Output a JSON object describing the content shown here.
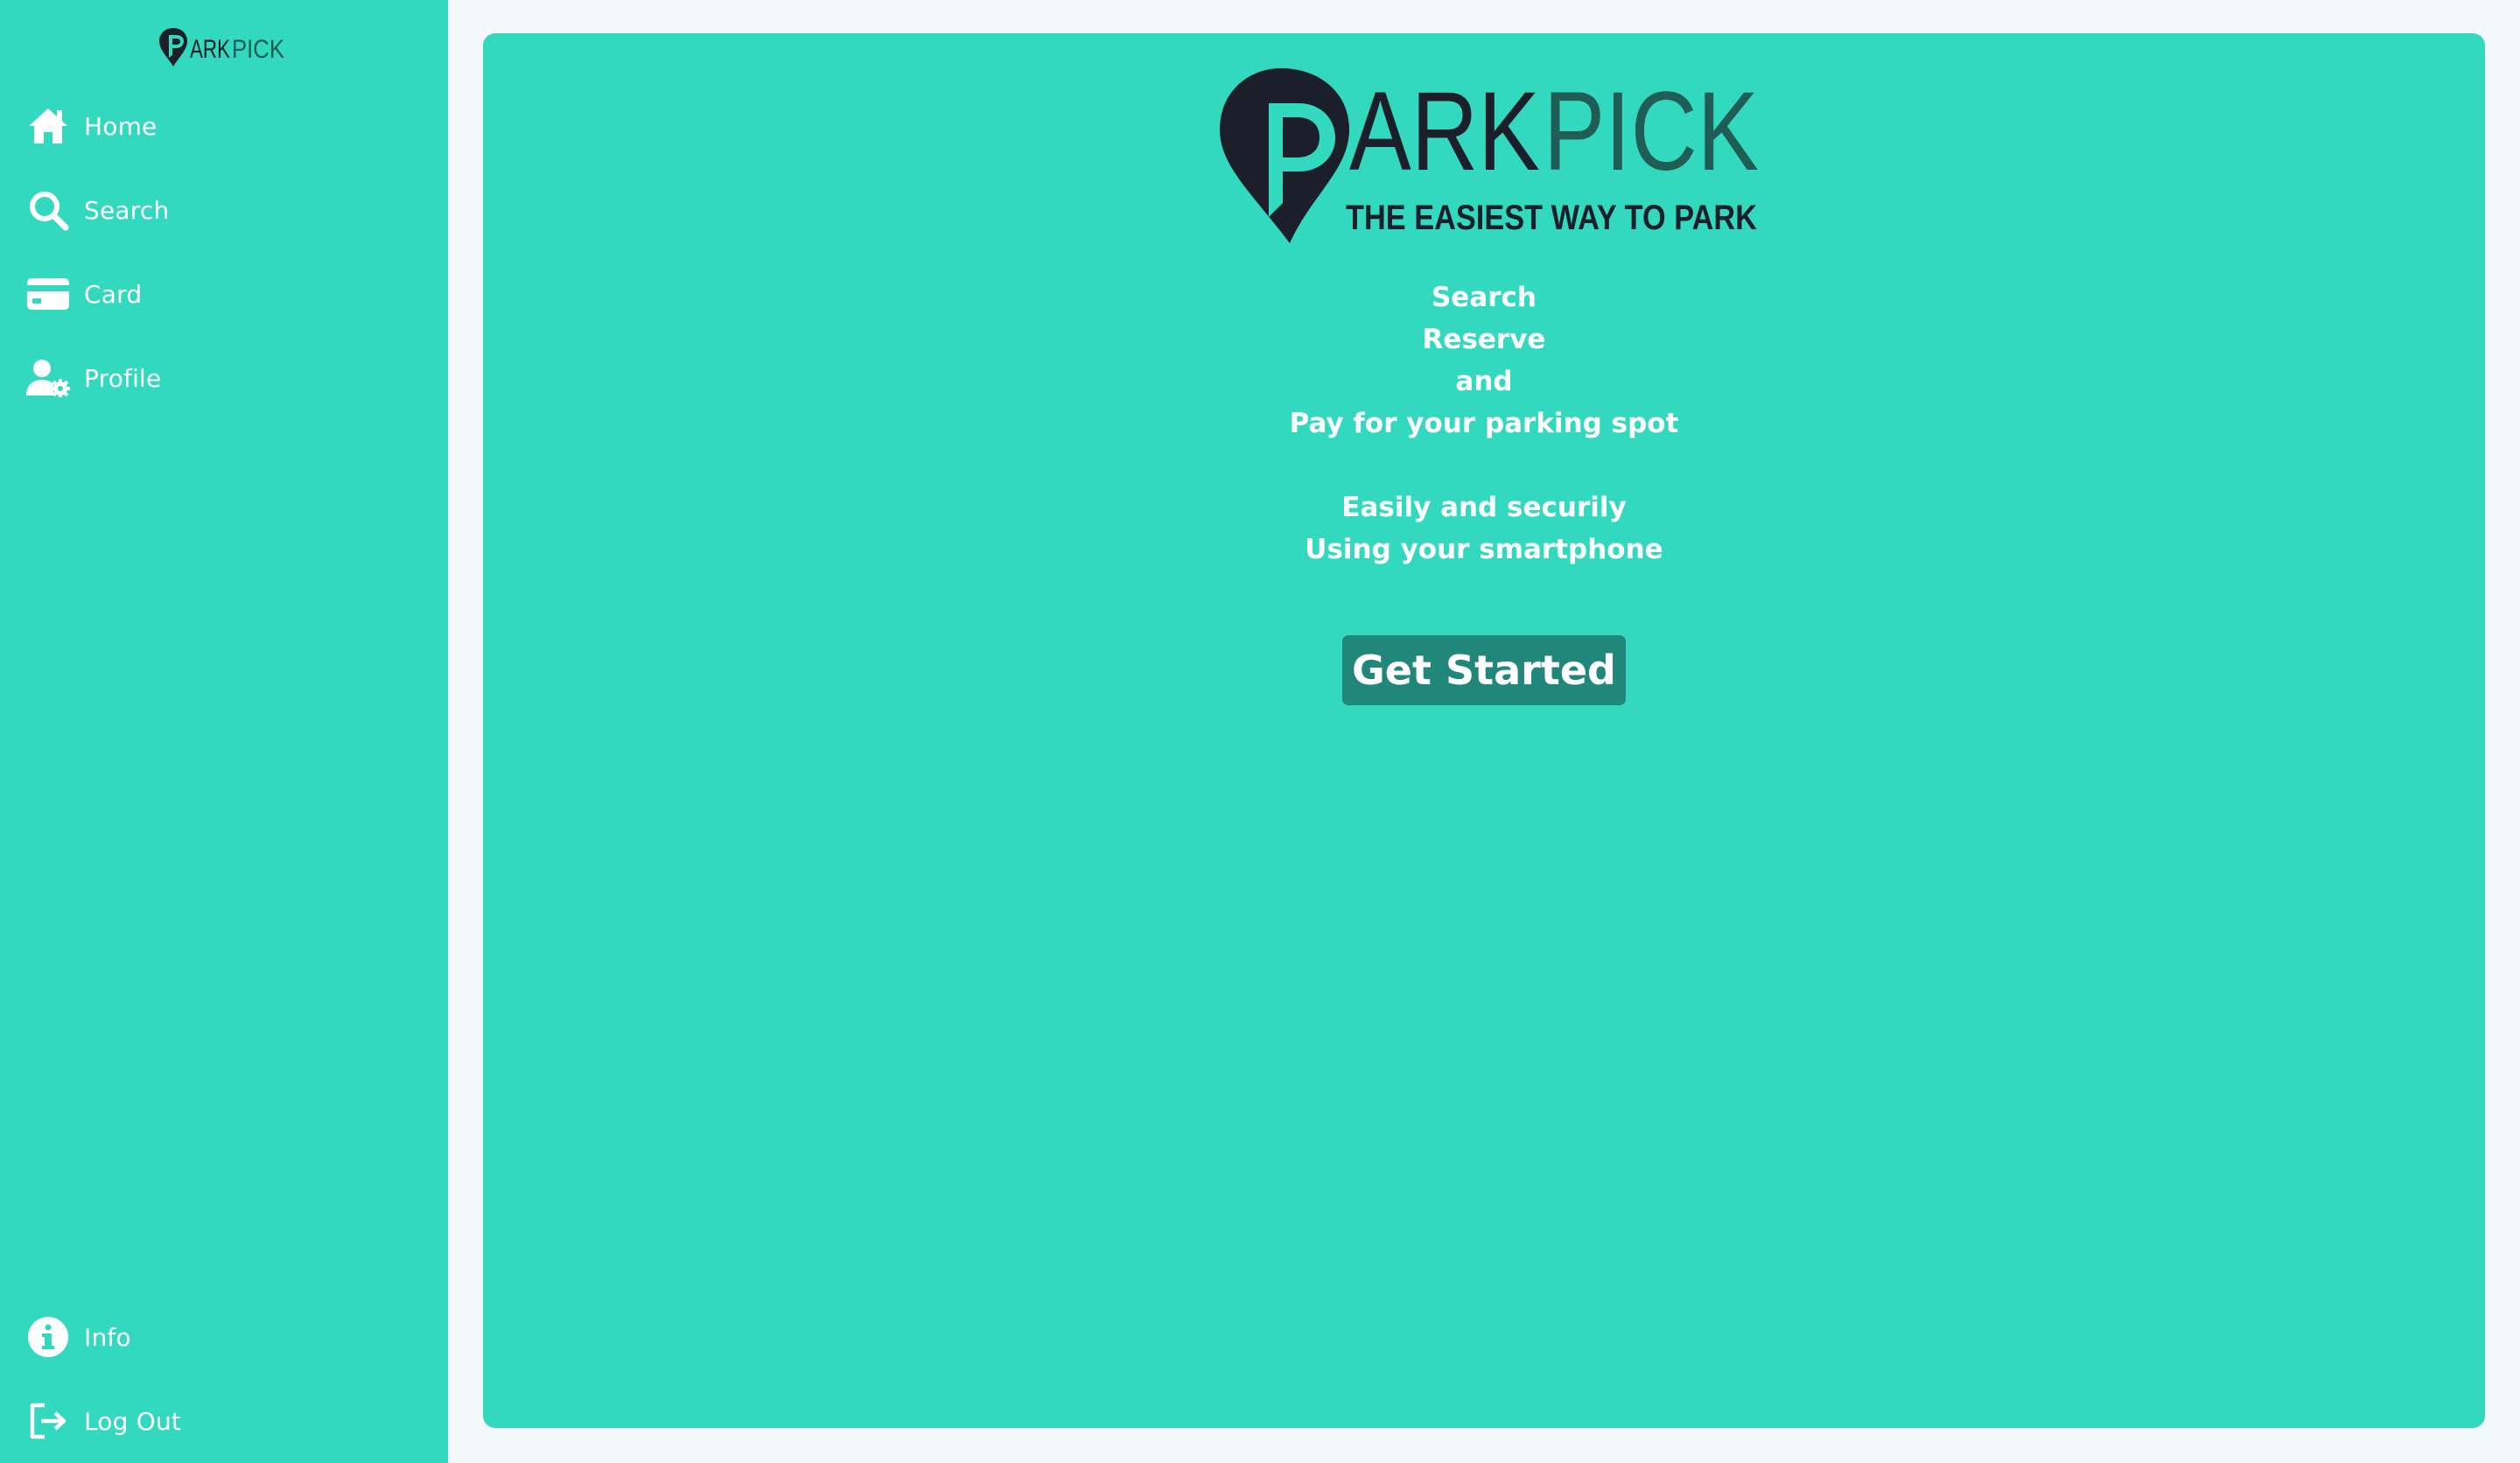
{
  "brand": {
    "logo_text": "PARKPICK",
    "logo_slogan": "THE EASIEST WAY TO PARK",
    "logo_dark": "#1b1f2a",
    "logo_accent": "#1f5d55"
  },
  "sidebar": {
    "background": "#33d9bf",
    "items": [
      {
        "label": "Home",
        "icon": "home-icon"
      },
      {
        "label": "Search",
        "icon": "search-icon"
      },
      {
        "label": "Card",
        "icon": "credit-card-icon"
      },
      {
        "label": "Profile",
        "icon": "user-settings-icon"
      }
    ],
    "bottom_items": [
      {
        "label": "Info",
        "icon": "info-icon"
      },
      {
        "label": "Log Out",
        "icon": "logout-icon"
      }
    ]
  },
  "main": {
    "background": "#33d9bf",
    "tagline_lines": [
      "Search",
      "Reserve",
      "and",
      "Pay for your parking spot"
    ],
    "tagline_lines_2": [
      "Easily and securily",
      "Using your smartphone"
    ],
    "cta_label": "Get Started",
    "cta_color": "#21877a"
  }
}
